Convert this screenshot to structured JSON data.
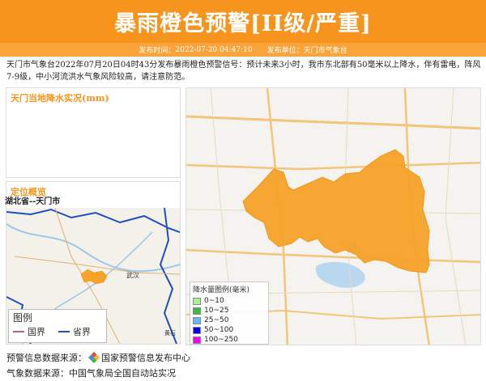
{
  "header": {
    "title": "暴雨橙色预警[II级/严重]",
    "release_time_label": "发布时间：",
    "release_time": "2022-07-20 04:47:10",
    "publisher_label": "发布单位：",
    "publisher": "天门市气象台"
  },
  "description": "天门市气象台2022年07月20日04时43分发布暴雨橙色预警信号：预计未来3小时，我市东北部有50毫米以上降水，伴有雷电，阵风7-9级，中小河流洪水气象风险较高，请注意防范。",
  "rain_panel": {
    "title": "天门当地降水实况(mm)"
  },
  "location_panel": {
    "title": "定位概览",
    "subtitle": "湖北省--天门市",
    "city_label": "武汉",
    "city2_label": "黄石",
    "legend": {
      "title": "图例",
      "items": [
        {
          "label": "国界",
          "color": "#c0607a"
        },
        {
          "label": "省界",
          "color": "#1f4fbf"
        }
      ]
    }
  },
  "main_map": {
    "region_color": "#f7a329",
    "legend": {
      "title": "降水量图例(毫米)",
      "items": [
        {
          "label": "0~10",
          "color": "#a6f28f"
        },
        {
          "label": "10~25",
          "color": "#3dba3d"
        },
        {
          "label": "25~50",
          "color": "#61b8ff"
        },
        {
          "label": "50~100",
          "color": "#0000fe"
        },
        {
          "label": "100~250",
          "color": "#fa00fa"
        }
      ]
    }
  },
  "footer": {
    "warning_source_label": "预警信息数据来源：",
    "warning_source": "国家预警信息发布中心",
    "weather_source_label": "气象数据来源：",
    "weather_source": "中国气象局全国自动站实况"
  },
  "colors": {
    "brand_orange": "#f7941d"
  }
}
